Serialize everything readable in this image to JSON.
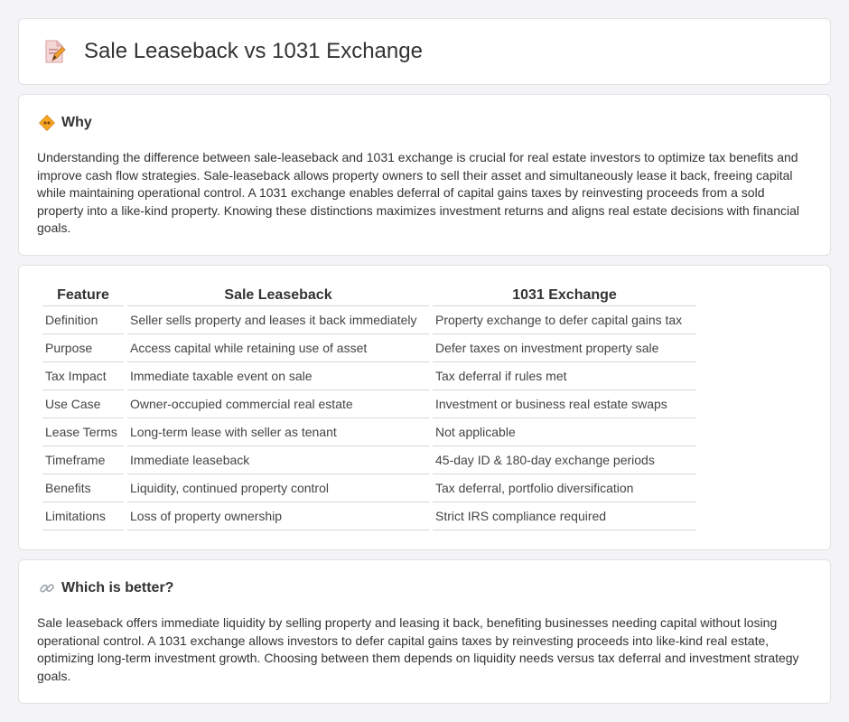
{
  "header": {
    "title": "Sale Leaseback vs 1031 Exchange",
    "icon": "document-pencil-icon"
  },
  "why": {
    "title": "Why",
    "icon": "diamond-sign-icon",
    "text": "Understanding the difference between sale-leaseback and 1031 exchange is crucial for real estate investors to optimize tax benefits and improve cash flow strategies. Sale-leaseback allows property owners to sell their asset and simultaneously lease it back, freeing capital while maintaining operational control. A 1031 exchange enables deferral of capital gains taxes by reinvesting proceeds from a sold property into a like-kind property. Knowing these distinctions maximizes investment returns and aligns real estate decisions with financial goals."
  },
  "comparison": {
    "headers": [
      "Feature",
      "Sale Leaseback",
      "1031 Exchange"
    ],
    "rows": [
      [
        "Definition",
        "Seller sells property and leases it back immediately",
        "Property exchange to defer capital gains tax"
      ],
      [
        "Purpose",
        "Access capital while retaining use of asset",
        "Defer taxes on investment property sale"
      ],
      [
        "Tax Impact",
        "Immediate taxable event on sale",
        "Tax deferral if rules met"
      ],
      [
        "Use Case",
        "Owner-occupied commercial real estate",
        "Investment or business real estate swaps"
      ],
      [
        "Lease Terms",
        "Long-term lease with seller as tenant",
        "Not applicable"
      ],
      [
        "Timeframe",
        "Immediate leaseback",
        "45-day ID & 180-day exchange periods"
      ],
      [
        "Benefits",
        "Liquidity, continued property control",
        "Tax deferral, portfolio diversification"
      ],
      [
        "Limitations",
        "Loss of property ownership",
        "Strict IRS compliance required"
      ]
    ]
  },
  "better": {
    "title": "Which is better?",
    "icon": "link-icon",
    "text": "Sale leaseback offers immediate liquidity by selling property and leasing it back, benefiting businesses needing capital without losing operational control. A 1031 exchange allows investors to defer capital gains taxes by reinvesting proceeds into like-kind real estate, optimizing long-term investment growth. Choosing between them depends on liquidity needs versus tax deferral and investment strategy goals."
  }
}
